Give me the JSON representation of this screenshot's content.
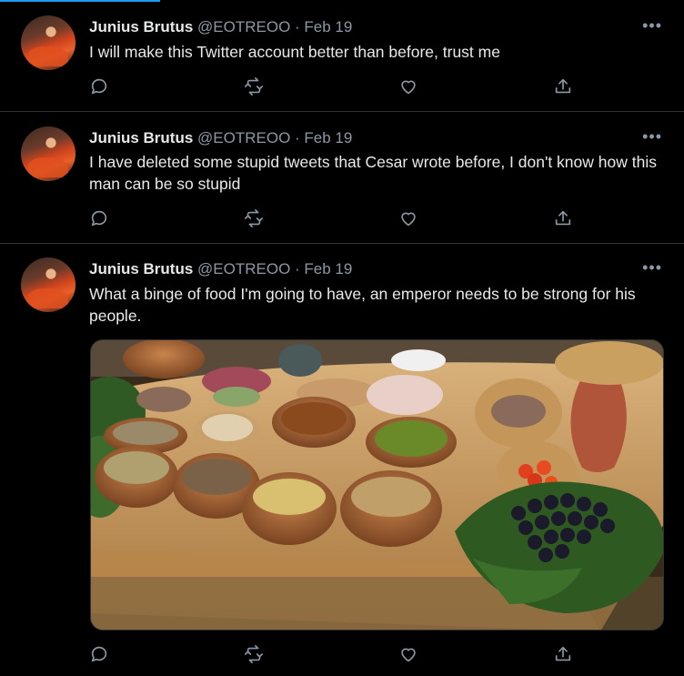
{
  "tweets": [
    {
      "name": "Junius Brutus",
      "handle": "@EOTREOO",
      "date": "· Feb 19",
      "text": "I will make this Twitter account better than before, trust me"
    },
    {
      "name": "Junius Brutus",
      "handle": "@EOTREOO",
      "date": "· Feb 19",
      "text": "I have deleted some stupid tweets that Cesar wrote before, I don't know how this man can be so stupid"
    },
    {
      "name": "Junius Brutus",
      "handle": "@EOTREOO",
      "date": "· Feb 19",
      "text": "What a binge of food I'm going to have, an emperor needs to be strong for his people."
    }
  ],
  "more_label": "•••",
  "icons": [
    "reply-icon",
    "retweet-icon",
    "like-icon",
    "share-icon"
  ],
  "colors": {
    "background": "#000000",
    "accent": "#1d9bf0",
    "muted": "#8b98a5"
  }
}
